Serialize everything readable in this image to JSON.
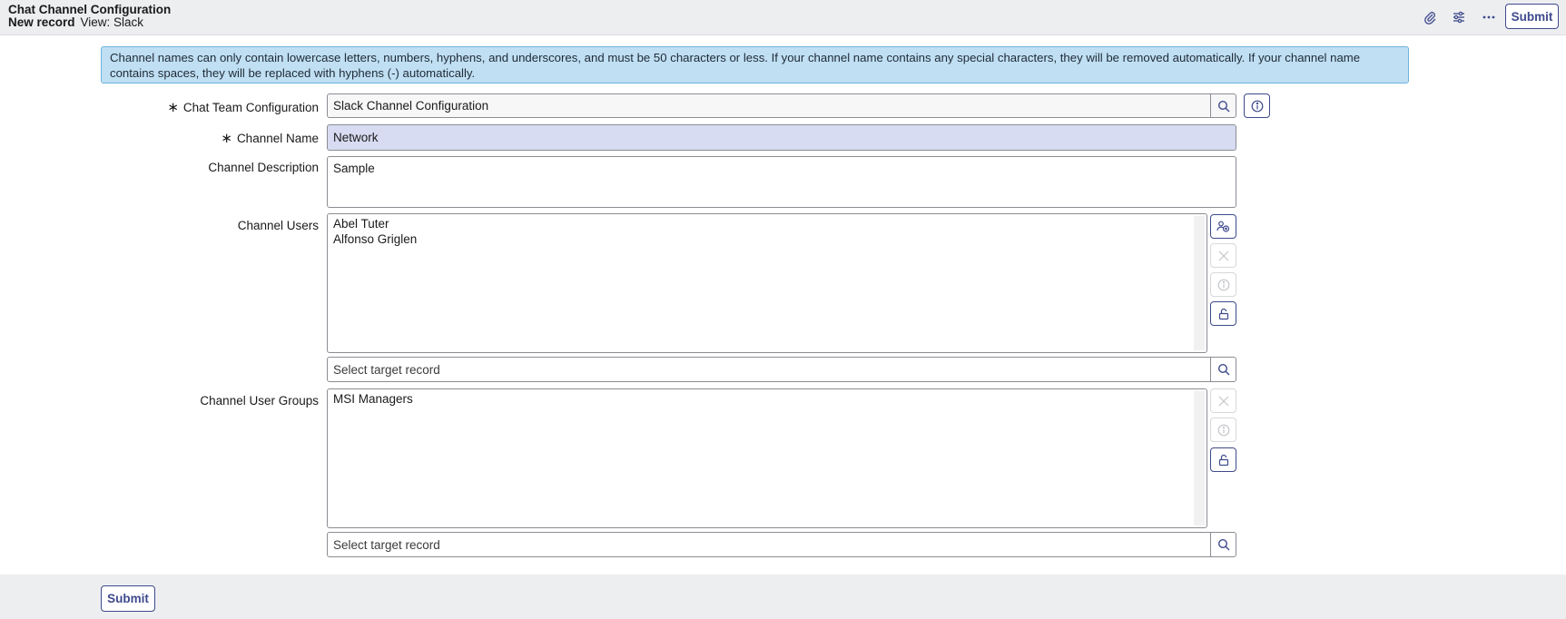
{
  "header": {
    "title": "Chat Channel Configuration",
    "record_status": "New record",
    "view": "View: Slack",
    "submit_label": "Submit",
    "icons": [
      "paperclip-icon",
      "sliders-icon",
      "more-icon"
    ]
  },
  "info_message": "Channel names can only contain lowercase letters, numbers, hyphens, and underscores, and must be 50 characters or less. If your channel name contains any special characters, they will be removed automatically. If your channel name contains spaces, they will be replaced with hyphens (-) automatically.",
  "form": {
    "required_marker": "∗",
    "chat_team_configuration": {
      "label": "Chat Team Configuration",
      "value": "Slack Channel Configuration"
    },
    "channel_name": {
      "label": "Channel Name",
      "value": "Network"
    },
    "channel_description": {
      "label": "Channel Description",
      "value": "Sample"
    },
    "channel_users": {
      "label": "Channel Users",
      "items": [
        "Abel Tuter",
        "Alfonso Griglen"
      ],
      "placeholder": "Select target record"
    },
    "channel_user_groups": {
      "label": "Channel User Groups",
      "items": [
        "MSI Managers"
      ],
      "placeholder": "Select target record"
    }
  },
  "footer": {
    "submit_label": "Submit"
  },
  "colors": {
    "accent": "#3e4a8c",
    "info_bg": "#c0dff3",
    "info_border": "#6eb3dd",
    "highlight_field": "#d8dcf2",
    "header_bg": "#edeef0"
  }
}
